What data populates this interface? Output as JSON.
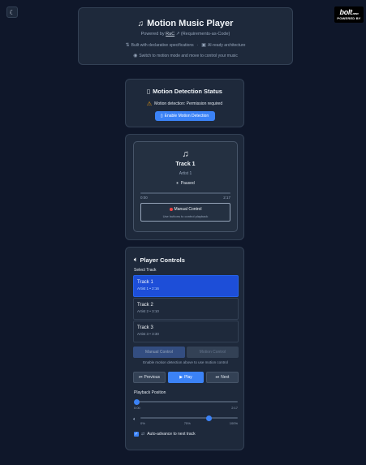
{
  "bolt": {
    "brand": "bolt",
    "suffix": ".new",
    "powered": "POWERED BY"
  },
  "header": {
    "title": "Motion Music Player",
    "powered_by": "Powered by",
    "rac_link": "RaC",
    "rac_full": "(Requirements-as-Code)",
    "feature_1": "Built with declarative specifications",
    "separator": "·",
    "feature_2": "AI-ready architecture",
    "hint": "Switch to motion mode and move to control your music"
  },
  "motion": {
    "title": "Motion Detection Status",
    "status": "Motion detection: Permission required",
    "enable_label": "Enable Motion Detection"
  },
  "player": {
    "track": "Track 1",
    "artist": "Artist 1",
    "state": "Paused",
    "time_current": "0:00",
    "time_total": "2:17",
    "progress": 0,
    "mode_title": "Manual Control",
    "mode_hint": "Use buttons to control playback"
  },
  "controls": {
    "title": "Player Controls",
    "select_label": "Select Track",
    "tracks": [
      {
        "name": "Track 1",
        "meta": "Artist 1 • 2:16",
        "active": true
      },
      {
        "name": "Track 2",
        "meta": "Artist 2 • 3:10",
        "active": false
      },
      {
        "name": "Track 3",
        "meta": "Artist 3 • 3:30",
        "active": false
      }
    ],
    "mode_manual": "Manual Control",
    "mode_motion": "Motion Control",
    "mode_hint": "Enable motion detection above to use motion control",
    "prev_label": "Previous",
    "play_label": "Play",
    "next_label": "Next",
    "position_label": "Playback Position",
    "pos_start": "0:00",
    "pos_end": "2:17",
    "position": 0,
    "vol_min": "0%",
    "vol_mid": "75%",
    "vol_max": "100%",
    "volume": 0.7,
    "auto_label": "Auto-advance to next track",
    "auto_checked": true
  }
}
